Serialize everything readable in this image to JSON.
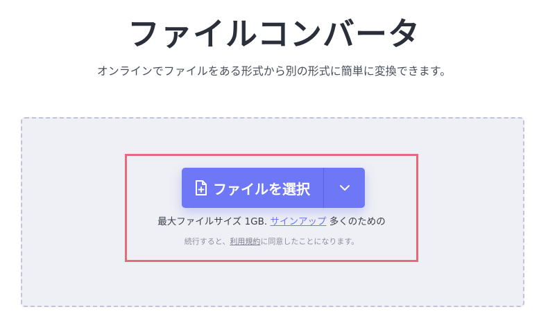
{
  "header": {
    "title": "ファイルコンバータ",
    "subtitle": "オンラインでファイルをある形式から別の形式に簡単に変換できます。"
  },
  "uploader": {
    "choose_button_label": "ファイルを選択",
    "choose_button_icon": "file-add-icon",
    "dropdown_icon": "chevron-down-icon",
    "info_prefix": "最大ファイルサイズ 1GB. ",
    "signup_link": "サインアップ",
    "info_suffix": " 多くのための",
    "terms_prefix": "続行すると、",
    "terms_link": "利用規約",
    "terms_suffix": "に同意したことになります。"
  },
  "colors": {
    "accent": "#6e77f5",
    "highlight_border": "#e46a7d",
    "dropzone_bg": "#eff0f5",
    "dropzone_border": "#c3c2d8",
    "title_text": "#2b2f3a"
  }
}
